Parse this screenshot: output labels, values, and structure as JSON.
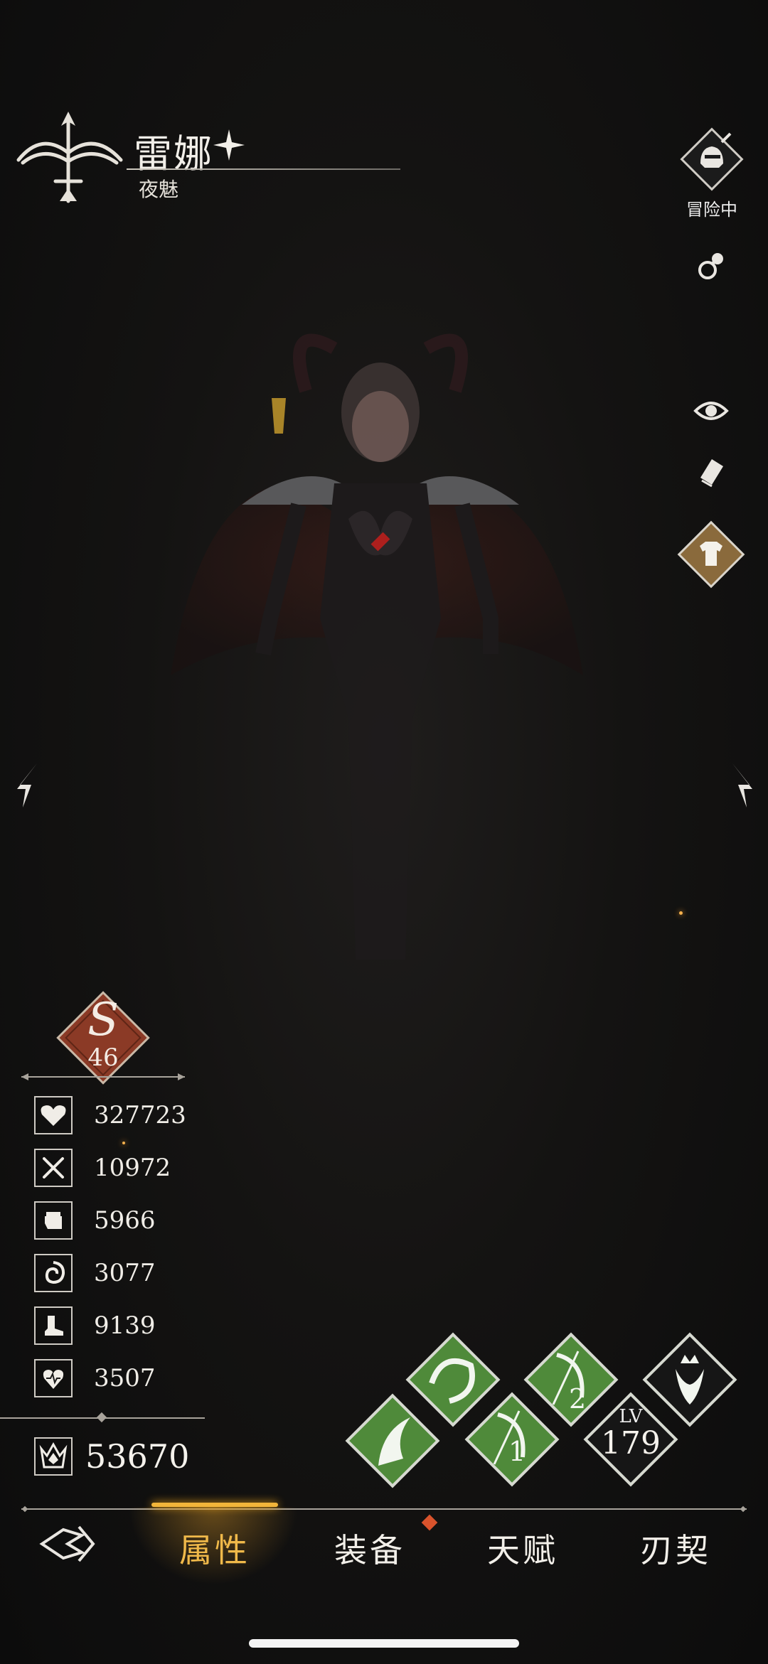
{
  "character": {
    "name": "雷娜",
    "title": "夜魅"
  },
  "status": {
    "label": "冒险中"
  },
  "rank": {
    "letter": "S",
    "value": "46"
  },
  "stats": [
    {
      "icon": "heart-icon",
      "value": "327723"
    },
    {
      "icon": "crossed-swords-icon",
      "value": "10972"
    },
    {
      "icon": "fist-icon",
      "value": "5966"
    },
    {
      "icon": "vortex-icon",
      "value": "3077"
    },
    {
      "icon": "boot-icon",
      "value": "9139"
    },
    {
      "icon": "heart-pulse-icon",
      "value": "3507"
    }
  ],
  "power": {
    "icon": "power-crown-icon",
    "value": "53670"
  },
  "skills": {
    "slot1": "1",
    "slot2": "2",
    "level_label": "LV",
    "level": "179"
  },
  "tabs": [
    {
      "label": "属性",
      "active": true
    },
    {
      "label": "装备",
      "active": false
    },
    {
      "label": "天赋",
      "active": false
    },
    {
      "label": "刃契",
      "active": false
    }
  ],
  "colors": {
    "accent": "#f0b94a",
    "skill_green": "#4f8a3a",
    "rank_red": "#8b3a26",
    "notify": "#d9532c"
  }
}
